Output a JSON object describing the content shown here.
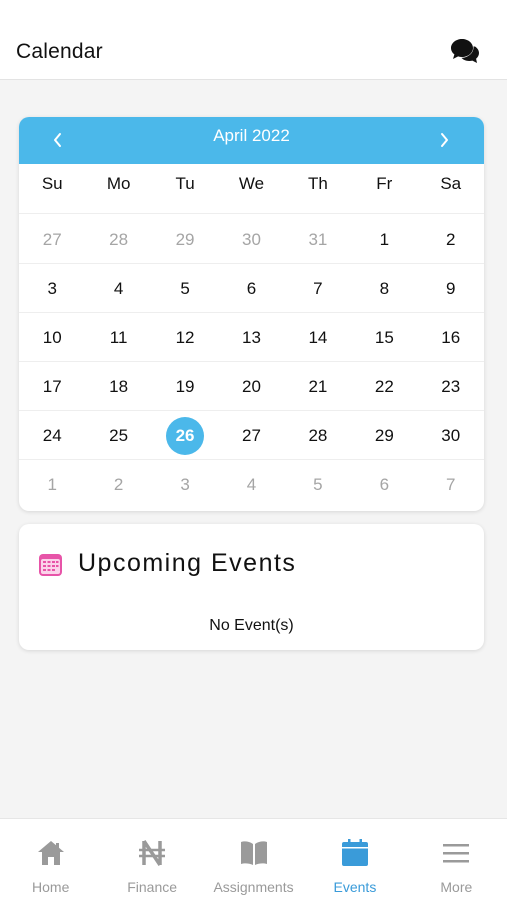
{
  "header": {
    "title": "Calendar",
    "chat_icon": "chat-bubbles-icon"
  },
  "calendar": {
    "month_label": "April 2022",
    "prev_icon": "chevron-left-icon",
    "next_icon": "chevron-right-icon",
    "weekdays": [
      "Su",
      "Mo",
      "Tu",
      "We",
      "Th",
      "Fr",
      "Sa"
    ],
    "weeks": [
      [
        {
          "d": "27",
          "m": true
        },
        {
          "d": "28",
          "m": true
        },
        {
          "d": "29",
          "m": true
        },
        {
          "d": "30",
          "m": true
        },
        {
          "d": "31",
          "m": true
        },
        {
          "d": "1"
        },
        {
          "d": "2"
        }
      ],
      [
        {
          "d": "3"
        },
        {
          "d": "4"
        },
        {
          "d": "5"
        },
        {
          "d": "6"
        },
        {
          "d": "7"
        },
        {
          "d": "8"
        },
        {
          "d": "9"
        }
      ],
      [
        {
          "d": "10"
        },
        {
          "d": "11"
        },
        {
          "d": "12"
        },
        {
          "d": "13"
        },
        {
          "d": "14"
        },
        {
          "d": "15"
        },
        {
          "d": "16"
        }
      ],
      [
        {
          "d": "17"
        },
        {
          "d": "18"
        },
        {
          "d": "19"
        },
        {
          "d": "20"
        },
        {
          "d": "21"
        },
        {
          "d": "22"
        },
        {
          "d": "23"
        }
      ],
      [
        {
          "d": "24"
        },
        {
          "d": "25"
        },
        {
          "d": "26",
          "s": true
        },
        {
          "d": "27"
        },
        {
          "d": "28"
        },
        {
          "d": "29"
        },
        {
          "d": "30"
        }
      ],
      [
        {
          "d": "1",
          "m": true
        },
        {
          "d": "2",
          "m": true
        },
        {
          "d": "3",
          "m": true
        },
        {
          "d": "4",
          "m": true
        },
        {
          "d": "5",
          "m": true
        },
        {
          "d": "6",
          "m": true
        },
        {
          "d": "7",
          "m": true
        }
      ]
    ],
    "accent_color": "#4bb8ea"
  },
  "events": {
    "title": "Upcoming Events",
    "empty_text": "No Event(s)",
    "icon": "calendar-icon"
  },
  "tabs": [
    {
      "label": "Home",
      "icon": "home-icon",
      "active": false
    },
    {
      "label": "Finance",
      "icon": "naira-icon",
      "active": false
    },
    {
      "label": "Assignments",
      "icon": "book-icon",
      "active": false
    },
    {
      "label": "Events",
      "icon": "calendar-icon",
      "active": true
    },
    {
      "label": "More",
      "icon": "menu-icon",
      "active": false
    }
  ],
  "colors": {
    "active_tab": "#3a9bd9",
    "inactive_tab": "#9a9a9a"
  }
}
